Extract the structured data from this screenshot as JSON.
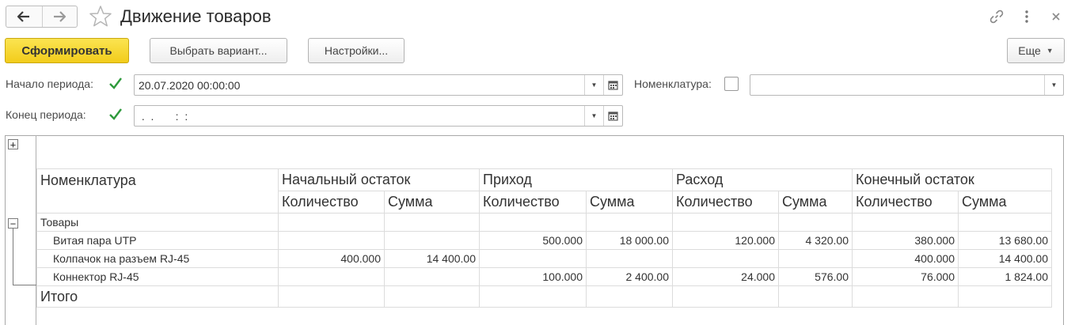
{
  "window": {
    "title": "Движение товаров",
    "nav_back": "🡐",
    "nav_forward": "🡒",
    "icons": [
      "back-arrow-icon",
      "forward-arrow-icon",
      "star-icon",
      "link-icon",
      "more-vertical-icon",
      "close-icon"
    ]
  },
  "toolbar": {
    "generate": "Сформировать",
    "choose_variant": "Выбрать вариант...",
    "settings": "Настройки...",
    "more": "Еще"
  },
  "filters": {
    "period_start_label": "Начало периода:",
    "period_start_value": "20.07.2020 00:00:00",
    "period_start_checked": true,
    "period_end_label": "Конец периода:",
    "period_end_value": " .  .       :  :",
    "period_end_checked": true,
    "nomenclature_label": "Номенклатура:",
    "nomenclature_value": "",
    "nomenclature_checked": false
  },
  "colors": {
    "primary_button": "#f2cc1b",
    "check_mark": "#2e9a3c",
    "grid_line": "#dcdcdc"
  },
  "report": {
    "headers": {
      "nomenclature": "Номенклатура",
      "opening": "Начальный остаток",
      "income": "Приход",
      "expense": "Расход",
      "closing": "Конечный остаток",
      "qty": "Количество",
      "sum": "Сумма"
    },
    "group": "Товары",
    "rows": [
      {
        "name": "Витая пара UTP",
        "open_qty": "",
        "open_sum": "",
        "in_qty": "500.000",
        "in_sum": "18 000.00",
        "out_qty": "120.000",
        "out_sum": "4 320.00",
        "close_qty": "380.000",
        "close_sum": "13 680.00"
      },
      {
        "name": "Колпачок на разъем RJ-45",
        "open_qty": "400.000",
        "open_sum": "14 400.00",
        "in_qty": "",
        "in_sum": "",
        "out_qty": "",
        "out_sum": "",
        "close_qty": "400.000",
        "close_sum": "14 400.00"
      },
      {
        "name": "Коннектор RJ-45",
        "open_qty": "",
        "open_sum": "",
        "in_qty": "100.000",
        "in_sum": "2 400.00",
        "out_qty": "24.000",
        "out_sum": "576.00",
        "close_qty": "76.000",
        "close_sum": "1 824.00"
      }
    ],
    "total_label": "Итого",
    "expand_symbol": "+",
    "collapse_symbol": "−"
  }
}
